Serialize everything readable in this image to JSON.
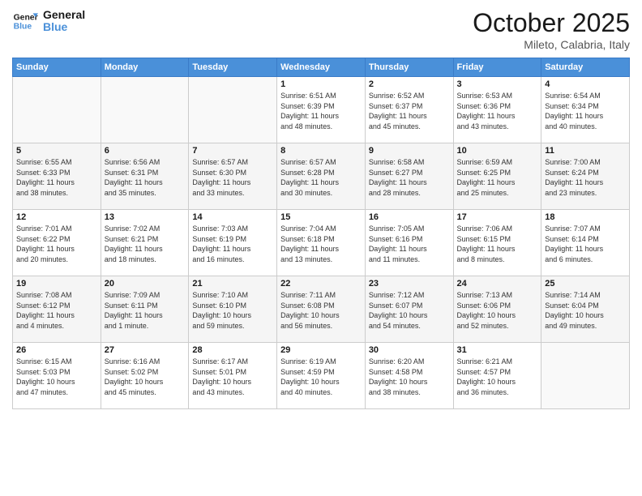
{
  "header": {
    "logo_line1": "General",
    "logo_line2": "Blue",
    "month": "October 2025",
    "location": "Mileto, Calabria, Italy"
  },
  "weekdays": [
    "Sunday",
    "Monday",
    "Tuesday",
    "Wednesday",
    "Thursday",
    "Friday",
    "Saturday"
  ],
  "weeks": [
    [
      {
        "day": "",
        "info": ""
      },
      {
        "day": "",
        "info": ""
      },
      {
        "day": "",
        "info": ""
      },
      {
        "day": "1",
        "info": "Sunrise: 6:51 AM\nSunset: 6:39 PM\nDaylight: 11 hours\nand 48 minutes."
      },
      {
        "day": "2",
        "info": "Sunrise: 6:52 AM\nSunset: 6:37 PM\nDaylight: 11 hours\nand 45 minutes."
      },
      {
        "day": "3",
        "info": "Sunrise: 6:53 AM\nSunset: 6:36 PM\nDaylight: 11 hours\nand 43 minutes."
      },
      {
        "day": "4",
        "info": "Sunrise: 6:54 AM\nSunset: 6:34 PM\nDaylight: 11 hours\nand 40 minutes."
      }
    ],
    [
      {
        "day": "5",
        "info": "Sunrise: 6:55 AM\nSunset: 6:33 PM\nDaylight: 11 hours\nand 38 minutes."
      },
      {
        "day": "6",
        "info": "Sunrise: 6:56 AM\nSunset: 6:31 PM\nDaylight: 11 hours\nand 35 minutes."
      },
      {
        "day": "7",
        "info": "Sunrise: 6:57 AM\nSunset: 6:30 PM\nDaylight: 11 hours\nand 33 minutes."
      },
      {
        "day": "8",
        "info": "Sunrise: 6:57 AM\nSunset: 6:28 PM\nDaylight: 11 hours\nand 30 minutes."
      },
      {
        "day": "9",
        "info": "Sunrise: 6:58 AM\nSunset: 6:27 PM\nDaylight: 11 hours\nand 28 minutes."
      },
      {
        "day": "10",
        "info": "Sunrise: 6:59 AM\nSunset: 6:25 PM\nDaylight: 11 hours\nand 25 minutes."
      },
      {
        "day": "11",
        "info": "Sunrise: 7:00 AM\nSunset: 6:24 PM\nDaylight: 11 hours\nand 23 minutes."
      }
    ],
    [
      {
        "day": "12",
        "info": "Sunrise: 7:01 AM\nSunset: 6:22 PM\nDaylight: 11 hours\nand 20 minutes."
      },
      {
        "day": "13",
        "info": "Sunrise: 7:02 AM\nSunset: 6:21 PM\nDaylight: 11 hours\nand 18 minutes."
      },
      {
        "day": "14",
        "info": "Sunrise: 7:03 AM\nSunset: 6:19 PM\nDaylight: 11 hours\nand 16 minutes."
      },
      {
        "day": "15",
        "info": "Sunrise: 7:04 AM\nSunset: 6:18 PM\nDaylight: 11 hours\nand 13 minutes."
      },
      {
        "day": "16",
        "info": "Sunrise: 7:05 AM\nSunset: 6:16 PM\nDaylight: 11 hours\nand 11 minutes."
      },
      {
        "day": "17",
        "info": "Sunrise: 7:06 AM\nSunset: 6:15 PM\nDaylight: 11 hours\nand 8 minutes."
      },
      {
        "day": "18",
        "info": "Sunrise: 7:07 AM\nSunset: 6:14 PM\nDaylight: 11 hours\nand 6 minutes."
      }
    ],
    [
      {
        "day": "19",
        "info": "Sunrise: 7:08 AM\nSunset: 6:12 PM\nDaylight: 11 hours\nand 4 minutes."
      },
      {
        "day": "20",
        "info": "Sunrise: 7:09 AM\nSunset: 6:11 PM\nDaylight: 11 hours\nand 1 minute."
      },
      {
        "day": "21",
        "info": "Sunrise: 7:10 AM\nSunset: 6:10 PM\nDaylight: 10 hours\nand 59 minutes."
      },
      {
        "day": "22",
        "info": "Sunrise: 7:11 AM\nSunset: 6:08 PM\nDaylight: 10 hours\nand 56 minutes."
      },
      {
        "day": "23",
        "info": "Sunrise: 7:12 AM\nSunset: 6:07 PM\nDaylight: 10 hours\nand 54 minutes."
      },
      {
        "day": "24",
        "info": "Sunrise: 7:13 AM\nSunset: 6:06 PM\nDaylight: 10 hours\nand 52 minutes."
      },
      {
        "day": "25",
        "info": "Sunrise: 7:14 AM\nSunset: 6:04 PM\nDaylight: 10 hours\nand 49 minutes."
      }
    ],
    [
      {
        "day": "26",
        "info": "Sunrise: 6:15 AM\nSunset: 5:03 PM\nDaylight: 10 hours\nand 47 minutes."
      },
      {
        "day": "27",
        "info": "Sunrise: 6:16 AM\nSunset: 5:02 PM\nDaylight: 10 hours\nand 45 minutes."
      },
      {
        "day": "28",
        "info": "Sunrise: 6:17 AM\nSunset: 5:01 PM\nDaylight: 10 hours\nand 43 minutes."
      },
      {
        "day": "29",
        "info": "Sunrise: 6:19 AM\nSunset: 4:59 PM\nDaylight: 10 hours\nand 40 minutes."
      },
      {
        "day": "30",
        "info": "Sunrise: 6:20 AM\nSunset: 4:58 PM\nDaylight: 10 hours\nand 38 minutes."
      },
      {
        "day": "31",
        "info": "Sunrise: 6:21 AM\nSunset: 4:57 PM\nDaylight: 10 hours\nand 36 minutes."
      },
      {
        "day": "",
        "info": ""
      }
    ]
  ]
}
